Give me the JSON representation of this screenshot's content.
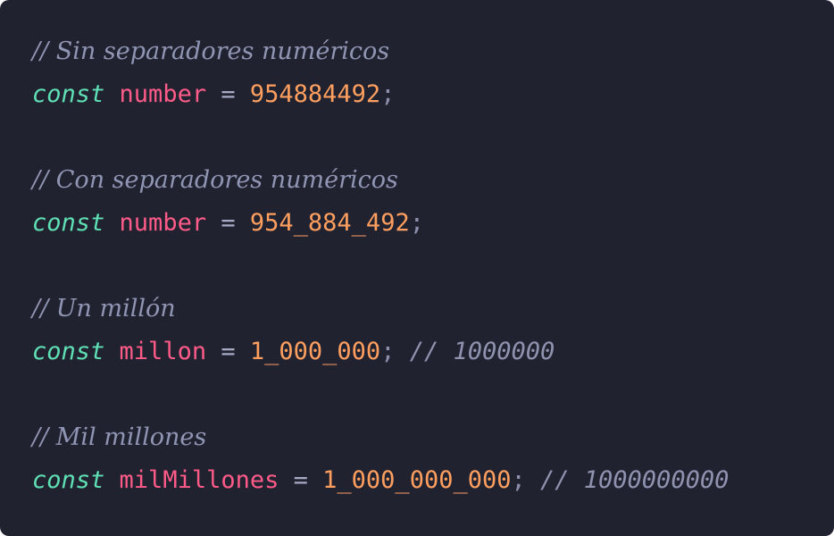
{
  "editor": {
    "lines": [
      {
        "comment": "// Sin separadores numéricos"
      },
      {
        "keyword": "const",
        "identifier": "number",
        "operator": "=",
        "value": "954884492",
        "terminator": ";"
      },
      {
        "comment": "// Con separadores numéricos"
      },
      {
        "keyword": "const",
        "identifier": "number",
        "operator": "=",
        "value": "954_884_492",
        "terminator": ";"
      },
      {
        "comment": "// Un millón"
      },
      {
        "keyword": "const",
        "identifier": "millon",
        "operator": "=",
        "value": "1_000_000",
        "terminator": ";",
        "trailing_comment": "// 1000000"
      },
      {
        "comment": "// Mil millones"
      },
      {
        "keyword": "const",
        "identifier": "milMillones",
        "operator": "=",
        "value": "1_000_000_000",
        "terminator": ";",
        "trailing_comment": "// 1000000000"
      }
    ]
  }
}
